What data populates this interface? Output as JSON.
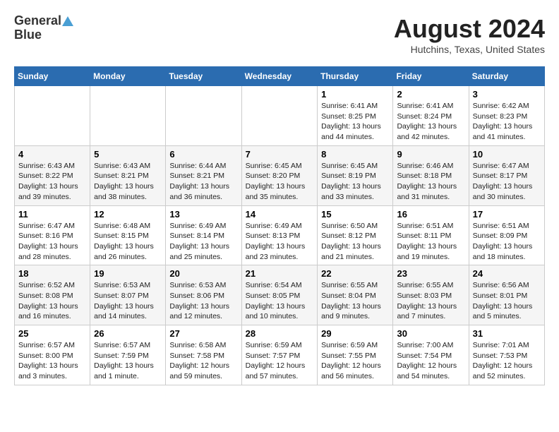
{
  "header": {
    "logo_line1": "General",
    "logo_line2": "Blue",
    "month": "August 2024",
    "location": "Hutchins, Texas, United States"
  },
  "weekdays": [
    "Sunday",
    "Monday",
    "Tuesday",
    "Wednesday",
    "Thursday",
    "Friday",
    "Saturday"
  ],
  "weeks": [
    [
      {
        "day": "",
        "content": ""
      },
      {
        "day": "",
        "content": ""
      },
      {
        "day": "",
        "content": ""
      },
      {
        "day": "",
        "content": ""
      },
      {
        "day": "1",
        "content": "Sunrise: 6:41 AM\nSunset: 8:25 PM\nDaylight: 13 hours\nand 44 minutes."
      },
      {
        "day": "2",
        "content": "Sunrise: 6:41 AM\nSunset: 8:24 PM\nDaylight: 13 hours\nand 42 minutes."
      },
      {
        "day": "3",
        "content": "Sunrise: 6:42 AM\nSunset: 8:23 PM\nDaylight: 13 hours\nand 41 minutes."
      }
    ],
    [
      {
        "day": "4",
        "content": "Sunrise: 6:43 AM\nSunset: 8:22 PM\nDaylight: 13 hours\nand 39 minutes."
      },
      {
        "day": "5",
        "content": "Sunrise: 6:43 AM\nSunset: 8:21 PM\nDaylight: 13 hours\nand 38 minutes."
      },
      {
        "day": "6",
        "content": "Sunrise: 6:44 AM\nSunset: 8:21 PM\nDaylight: 13 hours\nand 36 minutes."
      },
      {
        "day": "7",
        "content": "Sunrise: 6:45 AM\nSunset: 8:20 PM\nDaylight: 13 hours\nand 35 minutes."
      },
      {
        "day": "8",
        "content": "Sunrise: 6:45 AM\nSunset: 8:19 PM\nDaylight: 13 hours\nand 33 minutes."
      },
      {
        "day": "9",
        "content": "Sunrise: 6:46 AM\nSunset: 8:18 PM\nDaylight: 13 hours\nand 31 minutes."
      },
      {
        "day": "10",
        "content": "Sunrise: 6:47 AM\nSunset: 8:17 PM\nDaylight: 13 hours\nand 30 minutes."
      }
    ],
    [
      {
        "day": "11",
        "content": "Sunrise: 6:47 AM\nSunset: 8:16 PM\nDaylight: 13 hours\nand 28 minutes."
      },
      {
        "day": "12",
        "content": "Sunrise: 6:48 AM\nSunset: 8:15 PM\nDaylight: 13 hours\nand 26 minutes."
      },
      {
        "day": "13",
        "content": "Sunrise: 6:49 AM\nSunset: 8:14 PM\nDaylight: 13 hours\nand 25 minutes."
      },
      {
        "day": "14",
        "content": "Sunrise: 6:49 AM\nSunset: 8:13 PM\nDaylight: 13 hours\nand 23 minutes."
      },
      {
        "day": "15",
        "content": "Sunrise: 6:50 AM\nSunset: 8:12 PM\nDaylight: 13 hours\nand 21 minutes."
      },
      {
        "day": "16",
        "content": "Sunrise: 6:51 AM\nSunset: 8:11 PM\nDaylight: 13 hours\nand 19 minutes."
      },
      {
        "day": "17",
        "content": "Sunrise: 6:51 AM\nSunset: 8:09 PM\nDaylight: 13 hours\nand 18 minutes."
      }
    ],
    [
      {
        "day": "18",
        "content": "Sunrise: 6:52 AM\nSunset: 8:08 PM\nDaylight: 13 hours\nand 16 minutes."
      },
      {
        "day": "19",
        "content": "Sunrise: 6:53 AM\nSunset: 8:07 PM\nDaylight: 13 hours\nand 14 minutes."
      },
      {
        "day": "20",
        "content": "Sunrise: 6:53 AM\nSunset: 8:06 PM\nDaylight: 13 hours\nand 12 minutes."
      },
      {
        "day": "21",
        "content": "Sunrise: 6:54 AM\nSunset: 8:05 PM\nDaylight: 13 hours\nand 10 minutes."
      },
      {
        "day": "22",
        "content": "Sunrise: 6:55 AM\nSunset: 8:04 PM\nDaylight: 13 hours\nand 9 minutes."
      },
      {
        "day": "23",
        "content": "Sunrise: 6:55 AM\nSunset: 8:03 PM\nDaylight: 13 hours\nand 7 minutes."
      },
      {
        "day": "24",
        "content": "Sunrise: 6:56 AM\nSunset: 8:01 PM\nDaylight: 13 hours\nand 5 minutes."
      }
    ],
    [
      {
        "day": "25",
        "content": "Sunrise: 6:57 AM\nSunset: 8:00 PM\nDaylight: 13 hours\nand 3 minutes."
      },
      {
        "day": "26",
        "content": "Sunrise: 6:57 AM\nSunset: 7:59 PM\nDaylight: 13 hours\nand 1 minute."
      },
      {
        "day": "27",
        "content": "Sunrise: 6:58 AM\nSunset: 7:58 PM\nDaylight: 12 hours\nand 59 minutes."
      },
      {
        "day": "28",
        "content": "Sunrise: 6:59 AM\nSunset: 7:57 PM\nDaylight: 12 hours\nand 57 minutes."
      },
      {
        "day": "29",
        "content": "Sunrise: 6:59 AM\nSunset: 7:55 PM\nDaylight: 12 hours\nand 56 minutes."
      },
      {
        "day": "30",
        "content": "Sunrise: 7:00 AM\nSunset: 7:54 PM\nDaylight: 12 hours\nand 54 minutes."
      },
      {
        "day": "31",
        "content": "Sunrise: 7:01 AM\nSunset: 7:53 PM\nDaylight: 12 hours\nand 52 minutes."
      }
    ]
  ]
}
